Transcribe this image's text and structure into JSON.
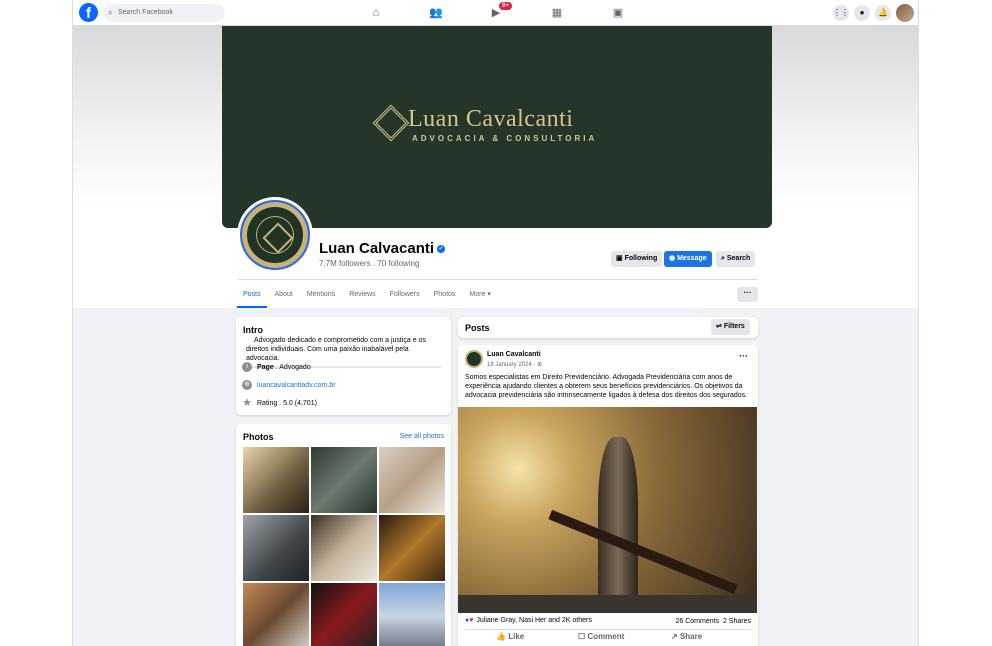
{
  "topbar": {
    "logo": "f",
    "search_placeholder": "Search Facebook",
    "video_badge": "9+",
    "icons": [
      "home-icon",
      "friends-icon",
      "video-icon",
      "marketplace-icon",
      "gaming-icon",
      "menu-grid-icon",
      "messenger-icon",
      "bell-icon"
    ]
  },
  "cover": {
    "title": "Luan Cavalcanti",
    "subtitle": "ADVOCACIA & CONSULTORIA"
  },
  "profile": {
    "name": "Luan Calvacanti",
    "stats": "7.7M followers . 70 following",
    "buttons": {
      "following": "Following",
      "message": "Message",
      "search": "Search"
    }
  },
  "tabs": [
    {
      "label": "Posts"
    },
    {
      "label": "About"
    },
    {
      "label": "Mentions"
    },
    {
      "label": "Reviews"
    },
    {
      "label": "Followers"
    },
    {
      "label": "Photos"
    },
    {
      "label": "More ▾"
    }
  ],
  "more_button": "···",
  "intro": {
    "title": "Intro",
    "bio": "Advogado dedicado e comprometido com a justiça e os direitos individuais. Com uma paixão inabalável pela advocacia.",
    "page_label": "Page",
    "page_category": ". Advogado",
    "website": "luancavalcantiadv.com.br",
    "rating": "Rating . 5.0 (4,701)"
  },
  "photos": {
    "title": "Photos",
    "see_all": "See all photos"
  },
  "posts": {
    "title": "Posts",
    "filters": "Filters"
  },
  "post": {
    "author": "Luan Cavalcanti",
    "date": "18 January 2024 · ",
    "text": "Somos especialistas em Direito Previdenciário. Advogada Previdenciária com anos de experiência ajudando clientes a obterem seus benefícios previdenciários. Os objetivos da advocacia previdenciária são intrinsecamente ligados à defesa dos direitos dos segurados.",
    "reactions": "Juliane Gray, Nasi Her and 2K others",
    "comments": "26 Comments",
    "shares": "2 Shares",
    "like": "Like",
    "comment": "Comment",
    "share": "Share",
    "menu": "···"
  },
  "colors": {
    "accent": "#0866ff",
    "cover_bg": "#233629",
    "gold": "#d8c48f"
  }
}
